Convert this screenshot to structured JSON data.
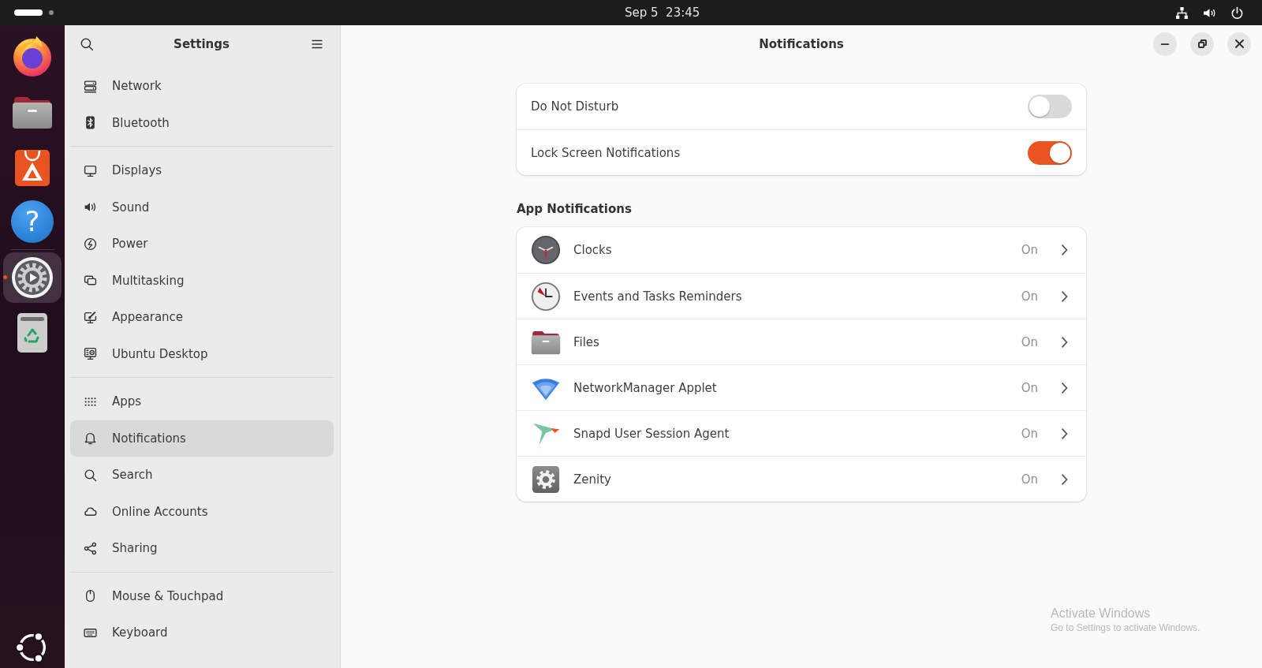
{
  "top_bar": {
    "clock": "Sep 5  23:45"
  },
  "dock": {
    "groups": [
      {
        "items": [
          {
            "kind": "browser",
            "selected": false,
            "running": false
          },
          {
            "kind": "folder",
            "selected": false,
            "running": false
          },
          {
            "kind": "store",
            "selected": false,
            "running": false
          },
          {
            "kind": "help",
            "glyph": "?",
            "selected": false,
            "running": false
          }
        ]
      },
      {
        "items": [
          {
            "kind": "settings",
            "selected": true,
            "running": true
          },
          {
            "kind": "trash",
            "selected": false,
            "running": false
          }
        ]
      }
    ]
  },
  "sidebar": {
    "title": "Settings",
    "groups": [
      {
        "items": [
          {
            "label": "Network",
            "kind": "network",
            "selected": false
          },
          {
            "label": "Bluetooth",
            "kind": "bluetooth",
            "selected": false
          }
        ]
      },
      {
        "items": [
          {
            "label": "Displays",
            "kind": "displays",
            "selected": false
          },
          {
            "label": "Sound",
            "kind": "sound",
            "selected": false
          },
          {
            "label": "Power",
            "kind": "power",
            "selected": false
          },
          {
            "label": "Multitasking",
            "kind": "multitasking",
            "selected": false
          },
          {
            "label": "Appearance",
            "kind": "appearance",
            "selected": false
          },
          {
            "label": "Ubuntu Desktop",
            "kind": "desktop",
            "selected": false
          }
        ]
      },
      {
        "items": [
          {
            "label": "Apps",
            "kind": "apps",
            "selected": false
          },
          {
            "label": "Notifications",
            "kind": "notifications",
            "selected": true
          },
          {
            "label": "Search",
            "kind": "search",
            "selected": false
          },
          {
            "label": "Online Accounts",
            "kind": "accounts",
            "selected": false
          },
          {
            "label": "Sharing",
            "kind": "sharing",
            "selected": false
          }
        ]
      },
      {
        "items": [
          {
            "label": "Mouse & Touchpad",
            "kind": "mouse",
            "selected": false
          },
          {
            "label": "Keyboard",
            "kind": "keyboard",
            "selected": false
          }
        ]
      }
    ]
  },
  "page": {
    "title": "Notifications",
    "switches": [
      {
        "label": "Do Not Disturb",
        "on": false
      },
      {
        "label": "Lock Screen Notifications",
        "on": true
      }
    ],
    "app_notifications": {
      "heading": "App Notifications",
      "apps": [
        {
          "name": "Clocks",
          "kind": "clock",
          "status": "On"
        },
        {
          "name": "Events and Tasks Reminders",
          "kind": "alarm",
          "status": "On"
        },
        {
          "name": "Files",
          "kind": "folder",
          "status": "On"
        },
        {
          "name": "NetworkManager Applet",
          "kind": "wifi",
          "status": "On"
        },
        {
          "name": "Snapd User Session Agent",
          "kind": "arrow",
          "status": "On"
        },
        {
          "name": "Zenity",
          "kind": "gear",
          "status": "On"
        }
      ]
    }
  },
  "activation_notice": {
    "title": "Activate Windows",
    "message": "Go to Settings to activate Windows."
  }
}
